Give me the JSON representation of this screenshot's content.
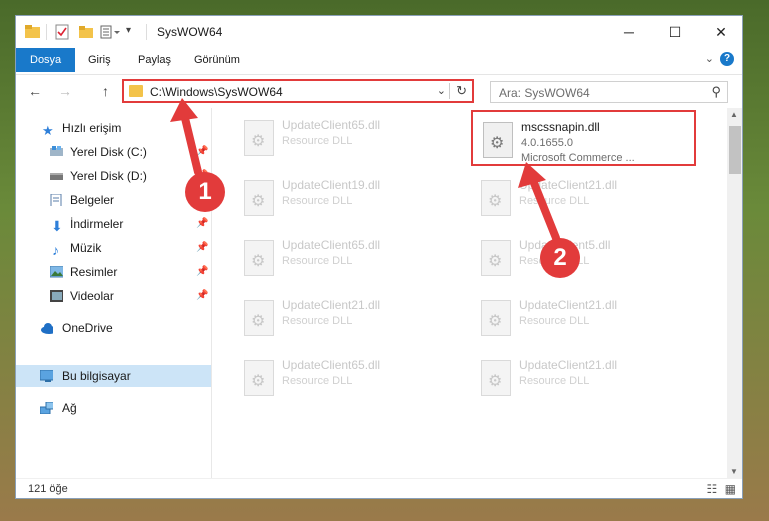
{
  "window": {
    "title": "SysWOW64",
    "controls": {
      "minimize": "─",
      "maximize": "☐",
      "close": "✕"
    }
  },
  "ribbon": {
    "tabs": [
      "Dosya",
      "Giriş",
      "Paylaş",
      "Görünüm"
    ],
    "active_tab": "Dosya"
  },
  "navbar": {
    "back": "←",
    "forward": "→",
    "up": "↑",
    "address": "C:\\Windows\\SysWOW64",
    "search_placeholder": "Ara: SysWOW64"
  },
  "sidebar": {
    "items": [
      {
        "label": "Hızlı erişim",
        "icon": "star-icon",
        "pinned": false
      },
      {
        "label": "Yerel Disk (C:)",
        "icon": "drive-icon",
        "pinned": true
      },
      {
        "label": "Yerel Disk (D:)",
        "icon": "drive-icon",
        "pinned": true
      },
      {
        "label": "Belgeler",
        "icon": "documents-icon",
        "pinned": true
      },
      {
        "label": "İndirmeler",
        "icon": "downloads-icon",
        "pinned": true
      },
      {
        "label": "Müzik",
        "icon": "music-icon",
        "pinned": true
      },
      {
        "label": "Resimler",
        "icon": "pictures-icon",
        "pinned": true
      },
      {
        "label": "Videolar",
        "icon": "videos-icon",
        "pinned": true
      },
      {
        "label": "OneDrive",
        "icon": "cloud-icon",
        "pinned": false
      },
      {
        "label": "Bu bilgisayar",
        "icon": "computer-icon",
        "pinned": false,
        "selected": true
      },
      {
        "label": "Ağ",
        "icon": "network-icon",
        "pinned": false
      }
    ]
  },
  "files": [
    {
      "name": "UpdateClient65.dll",
      "desc": "Resource DLL"
    },
    {
      "name": "mscssnapin.dll",
      "version": "4.0.1655.0",
      "desc": "Microsoft Commerce ...",
      "highlighted": true
    },
    {
      "name": "UpdateClient19.dll",
      "desc": "Resource DLL"
    },
    {
      "name": "UpdateClient21.dll",
      "desc": "Resource DLL"
    },
    {
      "name": "UpdateClient65.dll",
      "desc": "Resource DLL"
    },
    {
      "name": "UpdateClient5.dll",
      "desc": "Resource DLL"
    },
    {
      "name": "UpdateClient21.dll",
      "desc": "Resource DLL"
    },
    {
      "name": "UpdateClient21.dll",
      "desc": "Resource DLL"
    },
    {
      "name": "UpdateClient65.dll",
      "desc": "Resource DLL"
    },
    {
      "name": "UpdateClient21.dll",
      "desc": "Resource DLL"
    }
  ],
  "status": {
    "count": "121 öğe"
  },
  "annotations": {
    "step1": "1",
    "step2": "2",
    "accent": "#e23b3b"
  }
}
